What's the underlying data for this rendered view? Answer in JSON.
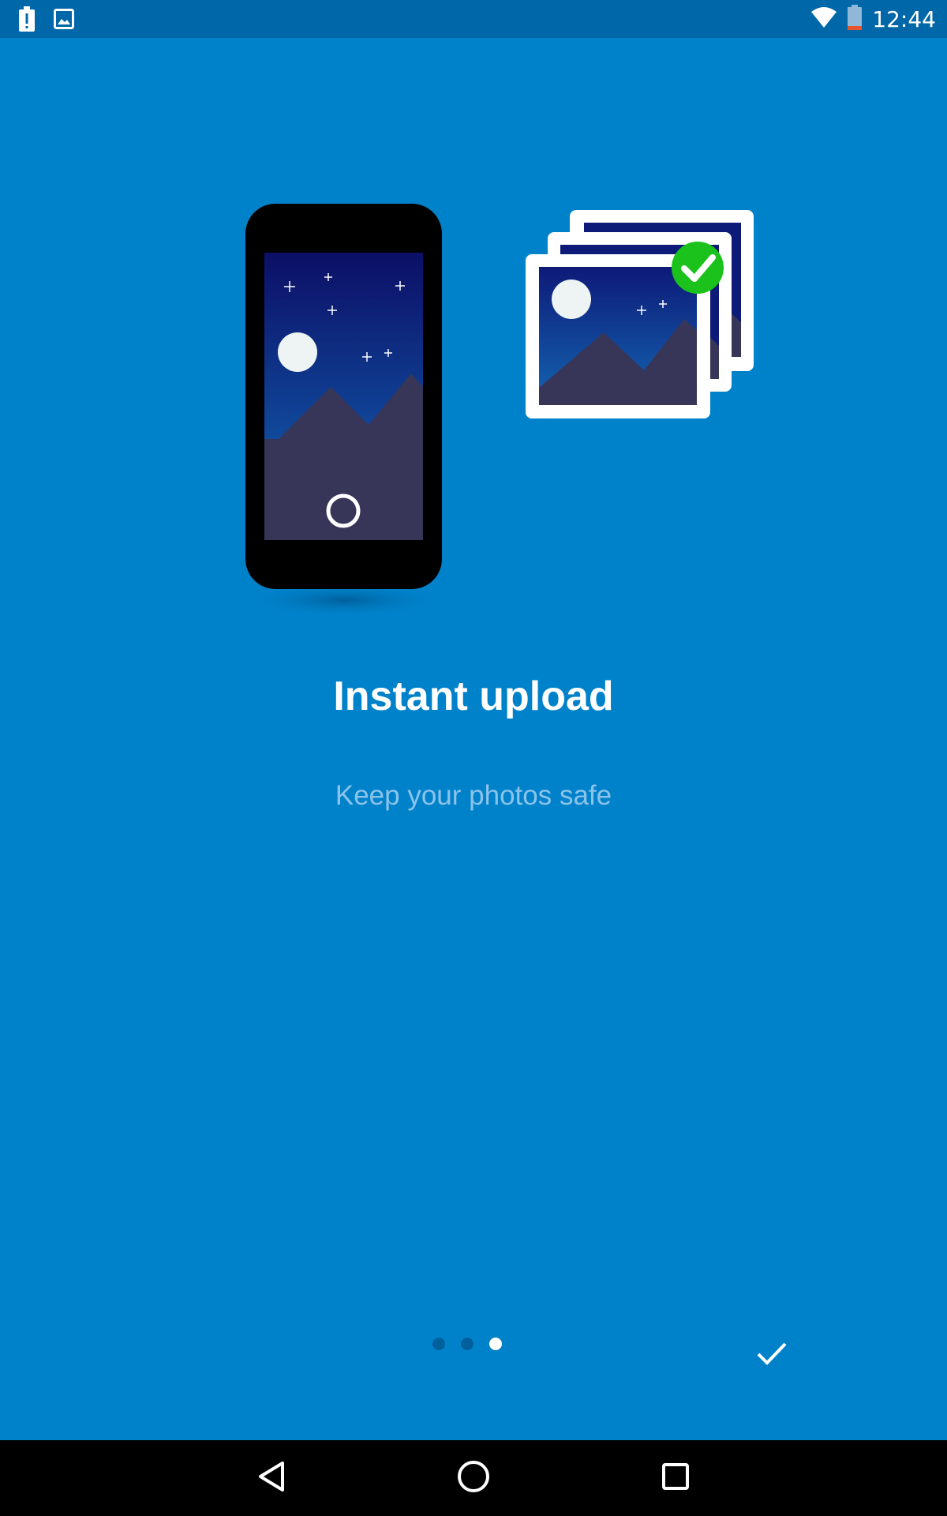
{
  "status_bar": {
    "time": "12:44",
    "icons": [
      "battery-alert-icon",
      "image-icon",
      "wifi-icon",
      "battery-icon"
    ]
  },
  "onboarding": {
    "title": "Instant upload",
    "subtitle": "Keep your photos safe",
    "page_count": 3,
    "current_page": 3
  },
  "colors": {
    "background": "#0082ca",
    "status_bar": "#0067a8",
    "check_badge": "#1bc21b"
  },
  "nav_bar": {
    "icons": [
      "back-icon",
      "home-icon",
      "recents-icon"
    ]
  }
}
